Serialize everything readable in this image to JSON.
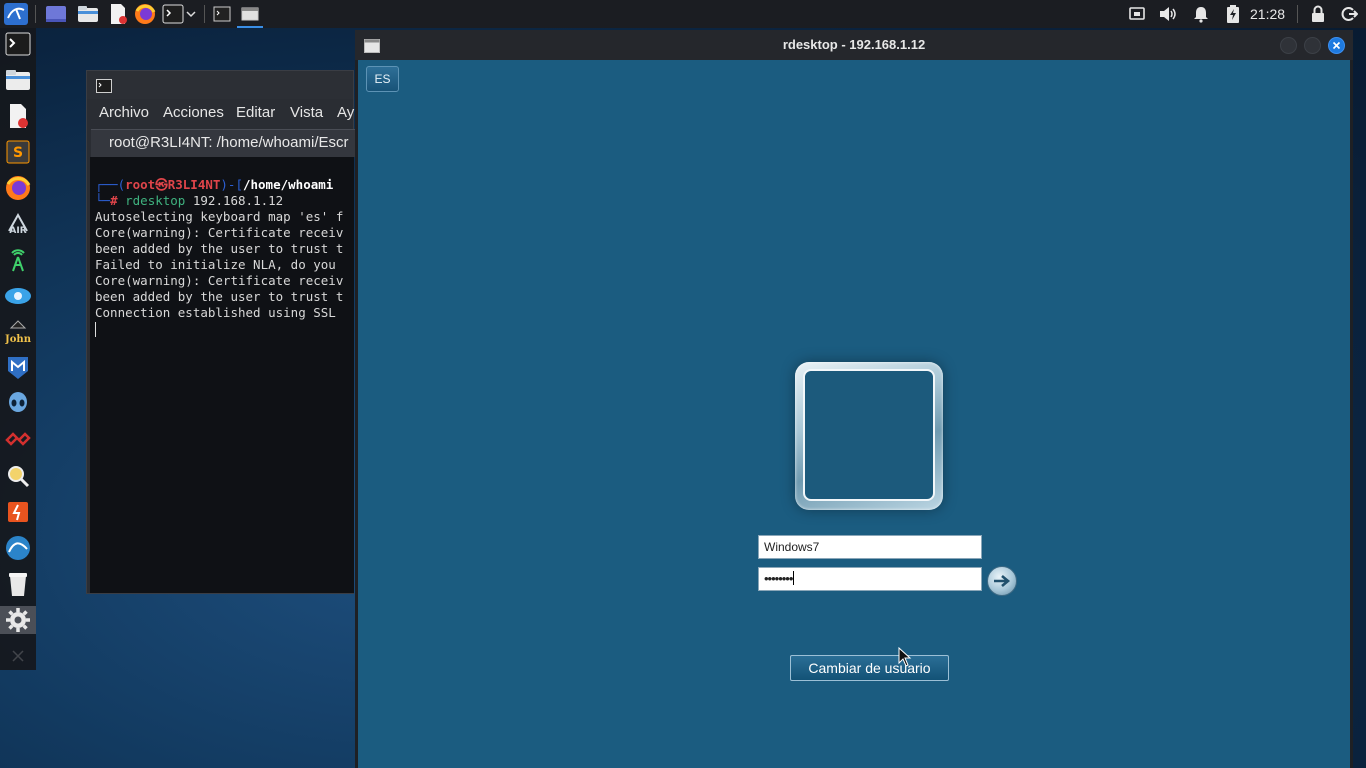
{
  "top_panel": {
    "clock": "21:28",
    "launchers": [
      "kali-menu-icon",
      "workspace-icon",
      "file-manager-icon",
      "text-editor-icon",
      "firefox-icon",
      "terminal-icon"
    ],
    "tasks": [
      "terminal-task-icon",
      "rdesktop-task-icon"
    ],
    "tray": [
      "network-icon",
      "volume-icon",
      "notification-bell-icon",
      "battery-charging-icon",
      "lock-icon",
      "logout-icon"
    ]
  },
  "dock": {
    "items": [
      "terminal-icon",
      "file-manager-icon",
      "text-editor-icon",
      "sublime-text-icon",
      "firefox-icon",
      "aircrack-icon",
      "kismet-icon",
      "network-scanner-icon",
      "john-icon",
      "metasploit-icon",
      "maltego-icon",
      "burp-icon",
      "search-tool-icon",
      "app-icon",
      "wireshark-icon",
      "trash-icon",
      "settings-icon"
    ]
  },
  "terminal": {
    "menu": [
      "Archivo",
      "Acciones",
      "Editar",
      "Vista",
      "Ay"
    ],
    "tab_title": "root@R3LI4NT: /home/whoami/Escr",
    "prompt": {
      "corner_top": "┌──(",
      "user_host": "root㉿R3LI4NT",
      "bracket_mid": ")-[",
      "path": "/home/whoami",
      "corner_bottom": "└─",
      "hash": "#",
      "command": "rdesktop",
      "argument": "192.168.1.12"
    },
    "output": [
      "Autoselecting keyboard map 'es' f",
      "Core(warning): Certificate receiv",
      "been added by the user to trust t",
      "Failed to initialize NLA, do you",
      "Core(warning): Certificate receiv",
      "been added by the user to trust t",
      "Connection established using SSL"
    ]
  },
  "rdesktop": {
    "title": "rdesktop - 192.168.1.12",
    "language_button": "ES",
    "username": "Windows7",
    "password_mask": "••••••••",
    "switch_user_button": "Cambiar de usuario"
  }
}
